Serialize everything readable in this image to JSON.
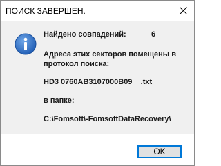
{
  "window": {
    "title": "ПОИСК ЗАВЕРШЕН.",
    "close_symbol": "✕"
  },
  "message": {
    "found_label": "Найдено совпадений:",
    "found_count": "6",
    "sectors_line1": "Адреса этих секторов помещены в",
    "sectors_line2": "протокол поиска:",
    "filename": "HD3 0760AB3107000B09    .txt",
    "folder_label": "в папке:",
    "folder_path": "C:\\Fomsoft\\-FomsoftDataRecovery\\"
  },
  "buttons": {
    "ok_label": "OK"
  },
  "icons": {
    "info": "info-icon",
    "close": "close-icon"
  },
  "colors": {
    "icon_blue": "#2b6cc4",
    "accent": "#0078d7"
  }
}
